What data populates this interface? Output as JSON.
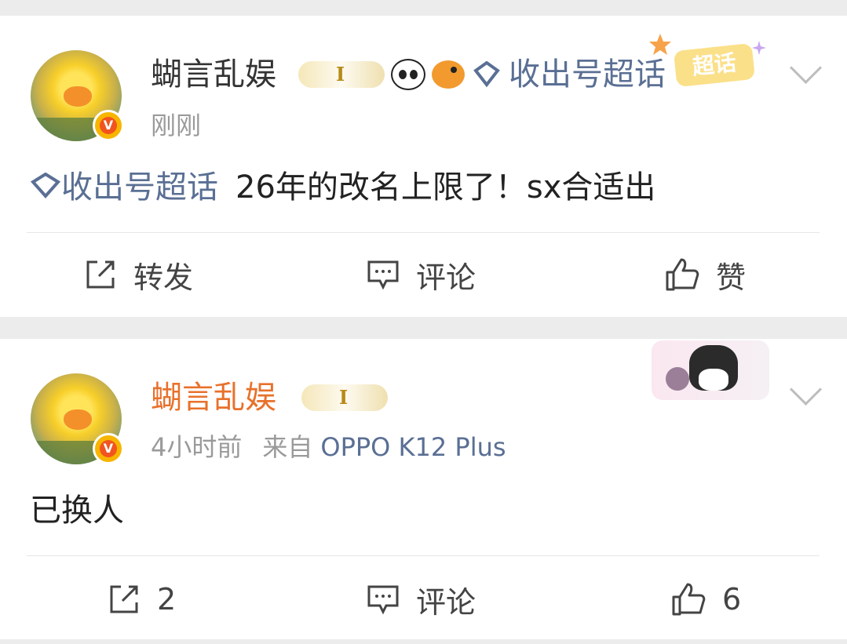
{
  "posts": [
    {
      "username": "蝴言乱娱",
      "username_color": "#333333",
      "level_badge": "I",
      "topic_tag": "收出号超话",
      "super_topic_label": "超话",
      "time": "刚刚",
      "topic": "收出号超话",
      "text": "26年的改名上限了！sx合适出",
      "actions": {
        "repost": "转发",
        "comment": "评论",
        "like": "赞"
      }
    },
    {
      "username": "蝴言乱娱",
      "username_color": "#e8712b",
      "level_badge": "I",
      "time": "4小时前",
      "source_prefix": "来自",
      "source": "OPPO K12 Plus",
      "text": "已换人",
      "actions": {
        "repost": "2",
        "comment": "评论",
        "like": "6"
      }
    }
  ],
  "icons": {
    "verified": "v-badge-icon",
    "repost": "share-icon",
    "comment": "comment-icon",
    "like": "thumbs-up-icon",
    "more": "chevron-down-icon",
    "topic": "diamond-icon"
  },
  "colors": {
    "link": "#5a6f94",
    "vip_name": "#e8712b",
    "badge": "#f7b500"
  }
}
